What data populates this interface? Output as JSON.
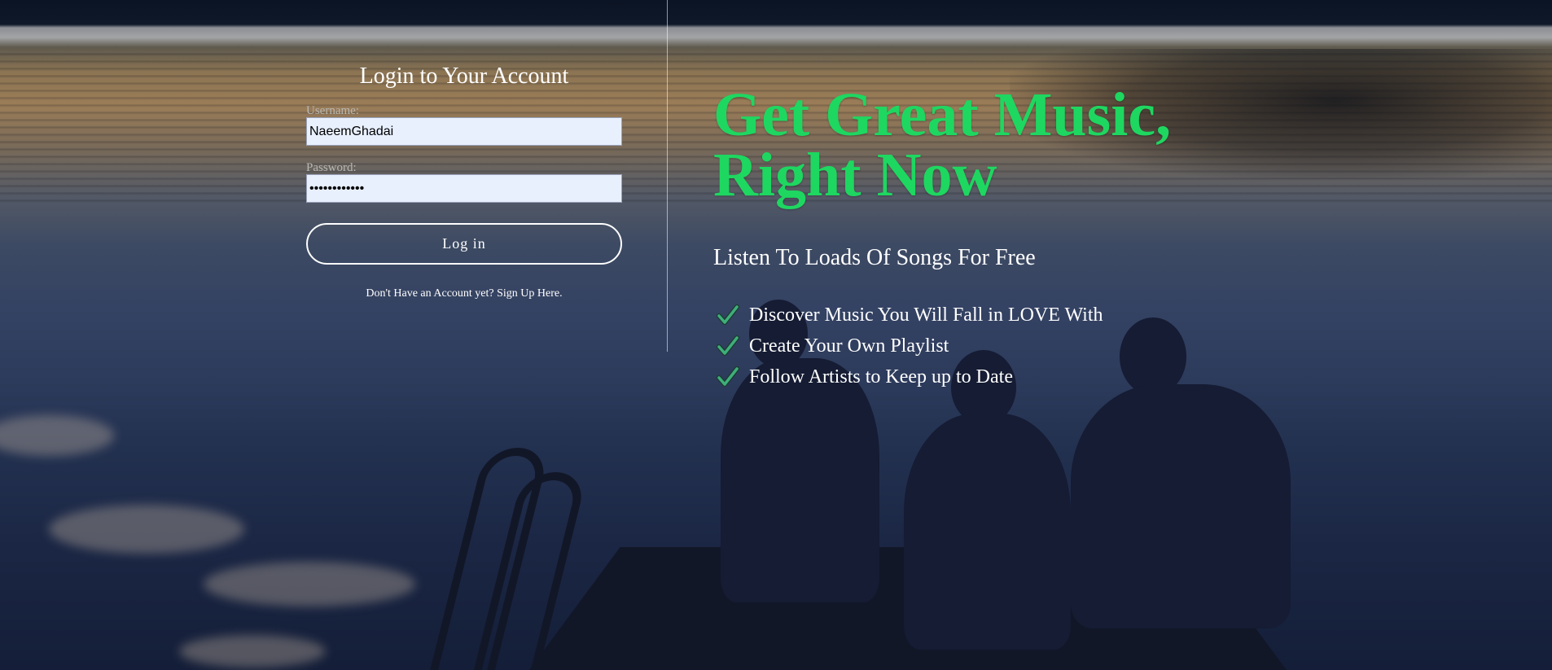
{
  "login": {
    "title": "Login to Your Account",
    "username_label": "Username:",
    "username_value": "NaeemGhadai",
    "password_label": "Password:",
    "password_value": "••••••••••••",
    "login_button": "Log in",
    "signup_link": "Don't Have an Account yet? Sign Up Here."
  },
  "hero": {
    "title_line1": "Get Great Music,",
    "title_line2": "Right Now",
    "subtitle": "Listen To Loads Of Songs For Free",
    "features": [
      {
        "icon": "check-icon",
        "text": "Discover Music You Will Fall in LOVE With"
      },
      {
        "icon": "check-icon",
        "text": "Create Your Own Playlist"
      },
      {
        "icon": "check-icon",
        "text": "Follow Artists to Keep up to Date"
      }
    ]
  },
  "colors": {
    "accent_green": "#1ed760",
    "input_background": "#e8f0fe",
    "check_green": "#3fae7a"
  },
  "background": {
    "image": "lake-at-dusk-with-people-on-dock"
  }
}
